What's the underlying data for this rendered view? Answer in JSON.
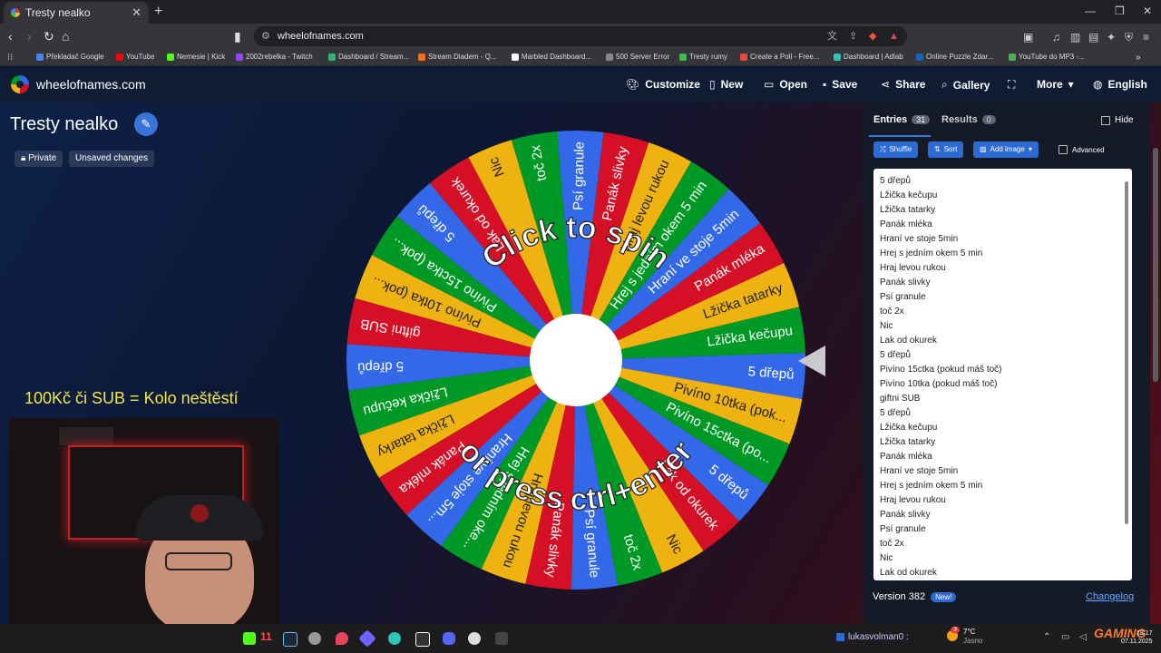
{
  "browser": {
    "tab_title": "Tresty nealko",
    "url": "wheelofnames.com",
    "bookmarks": [
      {
        "label": "Překladač Google",
        "color": "#4285f4"
      },
      {
        "label": "YouTube",
        "color": "#ff0000"
      },
      {
        "label": "Nemesie | Kick",
        "color": "#53fc18"
      },
      {
        "label": "2002rebelka - Twitch",
        "color": "#9146ff"
      },
      {
        "label": "Dashboard / Stream...",
        "color": "#2bb673"
      },
      {
        "label": "Stream Diadem - Q...",
        "color": "#ff6a13"
      },
      {
        "label": "Marbled Dashboard...",
        "color": "#ffffff"
      },
      {
        "label": "500 Server Error",
        "color": "#888888"
      },
      {
        "label": "Tresty rumy",
        "color": "#3cba54"
      },
      {
        "label": "Create a Poll - Free...",
        "color": "#e94b3c"
      },
      {
        "label": "Dashboard | Adlab",
        "color": "#2ec4b6"
      },
      {
        "label": "Online Puzzle Zdar...",
        "color": "#1565c0"
      },
      {
        "label": "YouTube do MP3 -...",
        "color": "#4caf50"
      }
    ]
  },
  "site": {
    "name": "wheelofnames.com",
    "nav": {
      "customize": "Customize",
      "new": "New",
      "open": "Open",
      "save": "Save",
      "share": "Share",
      "gallery": "Gallery",
      "more": "More",
      "language": "English"
    },
    "wheel_title": "Tresty nealko",
    "private_label": "Private",
    "unsaved_label": "Unsaved changes",
    "overlay_text": "100Kč či SUB = Kolo neštěstí",
    "spin_text_top": "Click to spin",
    "spin_text_bottom": "or press ctrl+enter"
  },
  "wheel": {
    "colors": [
      "#3369e8",
      "#009925",
      "#eeb211",
      "#d50f25"
    ],
    "start_angle_deg": 4,
    "slices": [
      "5 dřepů",
      "Lžička kečupu",
      "Lžička tatarky",
      "Panák mléka",
      "Hraní ve stoje 5min",
      "Hrej s jedním okem 5 min",
      "Hraj levou rukou",
      "Panák slivky",
      "Psí granule",
      "toč 2x",
      "Nic",
      "Lak od okurek",
      "5 dřepů",
      "Pivíno 15ctka (pok...",
      "Pivíno 10tka (pok...",
      "giftni SUB",
      "5 dřepů",
      "Lžička kečupu",
      "Lžička tatarky",
      "Panák mléka",
      "Hraní ve stoje 5m...",
      "Hrej s jedním oke...",
      "Hraj levou rukou",
      "Panák slivky",
      "Psí granule",
      "toč 2x",
      "Nic",
      "Lak od okurek",
      "5 dřepů",
      "Pivíno 15ctka (po...",
      "Pivíno 10tka (pok..."
    ]
  },
  "panel": {
    "entries_label": "Entries",
    "entries_count": "31",
    "results_label": "Results",
    "results_count": "0",
    "hide_label": "Hide",
    "shuffle_label": "Shuffle",
    "sort_label": "Sort",
    "add_image_label": "Add image",
    "advanced_label": "Advanced",
    "entries": [
      "5 dřepů",
      "Lžička kečupu",
      "Lžička tatarky",
      "Panák mléka",
      "Hraní ve stoje 5min",
      "Hrej s jedním okem 5 min",
      "Hraj levou rukou",
      "Panák slivky",
      "Psí granule",
      "toč 2x",
      "Nic",
      "Lak od okurek",
      "5 dřepů",
      "Pivíno 15ctka (pokud máš toč)",
      "Pivíno 10tka (pokud máš toč)",
      "giftni SUB",
      "5 dřepů",
      "Lžička kečupu",
      "Lžička tatarky",
      "Panák mléka",
      "Hraní ve stoje 5min",
      "Hrej s jedním okem 5 min",
      "Hraj levou rukou",
      "Panák slivky",
      "Psí granule",
      "toč 2x",
      "Nic",
      "Lak od okurek"
    ],
    "version_label": "Version 382",
    "new_badge": "New!",
    "changelog_label": "Changelog"
  },
  "taskbar": {
    "kick_count": "11",
    "chat_user": "lukasvolman0 :",
    "weather_temp": "7°C",
    "weather_desc": "Jasno",
    "weather_badge": "3",
    "clock_time": "18:17",
    "clock_date": "07.11.2025",
    "overlay_logo": "GAMING"
  }
}
